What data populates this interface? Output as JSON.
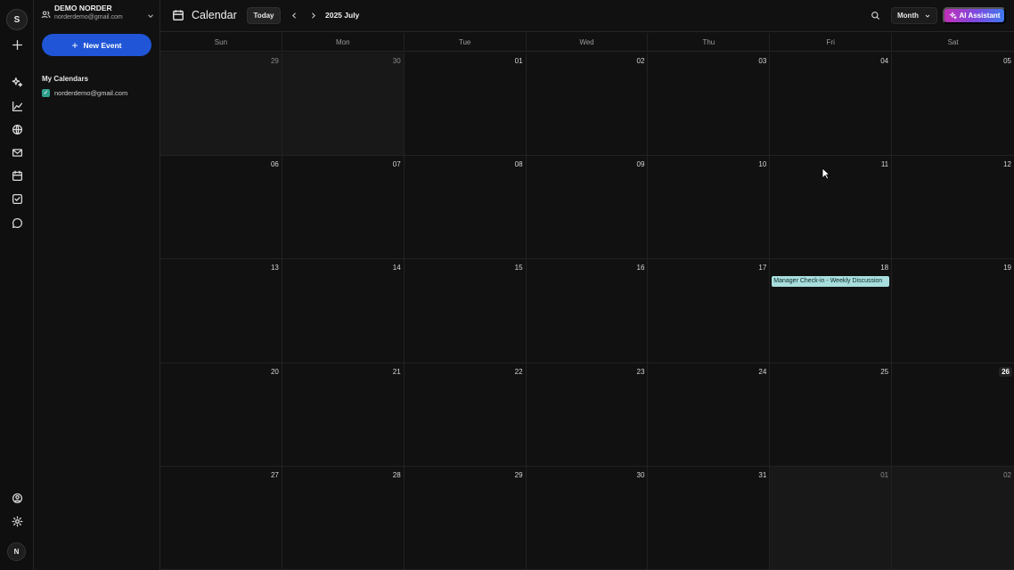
{
  "rail": {
    "workspace_initial": "S",
    "user_initial": "N",
    "items": [
      "plus-icon",
      "sparkles-icon",
      "chart-line-icon",
      "globe-icon",
      "mail-icon",
      "calendar-icon",
      "check-square-icon",
      "chat-bubble-icon",
      "user-circle-icon",
      "gear-icon"
    ]
  },
  "account": {
    "name": "DEMO NORDER",
    "email": "norderdemo@gmail.com"
  },
  "sidebar": {
    "new_event_label": "New Event",
    "my_calendars_title": "My Calendars",
    "calendars": [
      {
        "label": "norderdemo@gmail.com",
        "checked": true,
        "color": "#2f9e8c"
      }
    ]
  },
  "header": {
    "title": "Calendar",
    "today_label": "Today",
    "period_label": "2025 July",
    "view_label": "Month",
    "ai_label": "AI Assistant"
  },
  "weekdays": [
    "Sun",
    "Mon",
    "Tue",
    "Wed",
    "Thu",
    "Fri",
    "Sat"
  ],
  "days": [
    {
      "num": "29",
      "outside": true
    },
    {
      "num": "30",
      "outside": true
    },
    {
      "num": "01"
    },
    {
      "num": "02"
    },
    {
      "num": "03"
    },
    {
      "num": "04"
    },
    {
      "num": "05"
    },
    {
      "num": "06"
    },
    {
      "num": "07"
    },
    {
      "num": "08"
    },
    {
      "num": "09"
    },
    {
      "num": "10"
    },
    {
      "num": "11"
    },
    {
      "num": "12"
    },
    {
      "num": "13"
    },
    {
      "num": "14"
    },
    {
      "num": "15"
    },
    {
      "num": "16"
    },
    {
      "num": "17"
    },
    {
      "num": "18",
      "events": [
        "Manager Check-in - Weekly Discussion"
      ]
    },
    {
      "num": "19"
    },
    {
      "num": "20"
    },
    {
      "num": "21"
    },
    {
      "num": "22"
    },
    {
      "num": "23"
    },
    {
      "num": "24"
    },
    {
      "num": "25"
    },
    {
      "num": "26",
      "today": true
    },
    {
      "num": "27"
    },
    {
      "num": "28"
    },
    {
      "num": "29"
    },
    {
      "num": "30"
    },
    {
      "num": "31"
    },
    {
      "num": "01",
      "outside": true
    },
    {
      "num": "02",
      "outside": true
    }
  ],
  "colors": {
    "accent": "#1f55d6",
    "event_bg": "#a8dede",
    "ai_gradient": [
      "#c02fb8",
      "#3f78ee"
    ]
  }
}
